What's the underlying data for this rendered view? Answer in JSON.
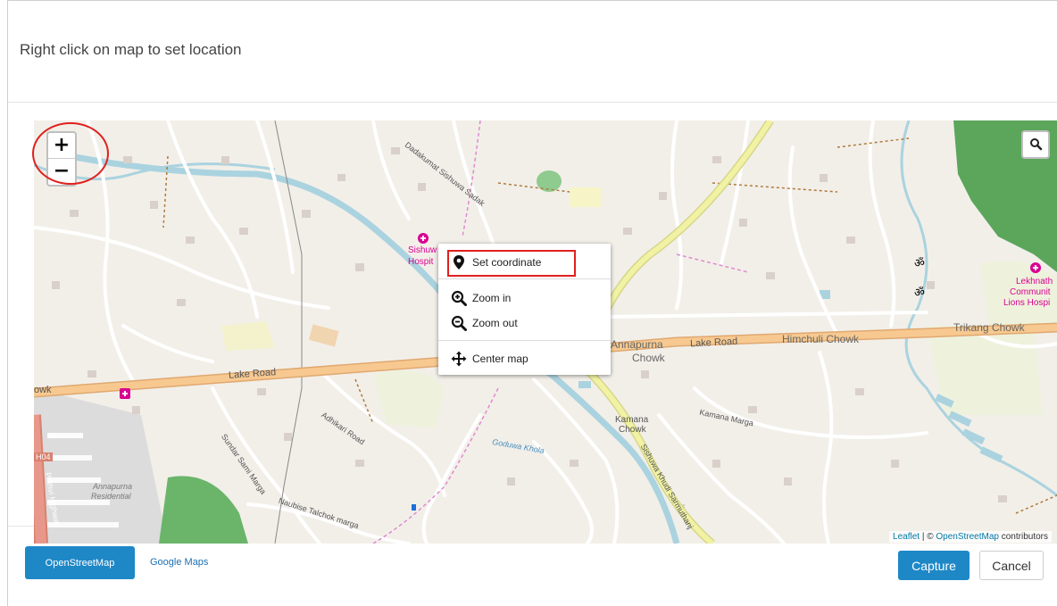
{
  "dialog": {
    "title": "Right click on map to set location"
  },
  "map": {
    "zoom_in_label": "+",
    "zoom_out_label": "−",
    "labels": {
      "lake_road_left": "Lake Road",
      "lake_road_mid": "Lake Road",
      "owk": "owk",
      "sishuwa": "Sishuw",
      "hospit": "Hospit",
      "annapurna": "Annapurna",
      "chowk": "Chowk",
      "himchuli": "Himchuli Chowk",
      "trikang": "Trikang Chowk",
      "lekhnath1": "Lekhnath",
      "lekhnath2": "Communit",
      "lekhnath3": "Lions Hospi",
      "kamana1": "Kamana",
      "kamana2": "Chowk",
      "kamana_marga": "Kamana Marga",
      "goduwa": "Goduwa Khola",
      "adhikari": "Adhikari Road",
      "sundar": "Sundar Sami Marga",
      "naubise": "Naubise Talchok marga",
      "annapurna_res1": "Annapurna",
      "annapurna_res2": "Residential",
      "prithvi": "Prithvi Highway",
      "h04": "H04",
      "sishuwa_sadak": "Dadakumat Sishuwa Sadak",
      "sishuwa_khudi": "Sishuwa Khudi Sarmuthanj",
      "om1": "ॐ",
      "om2": "ॐ"
    },
    "context_menu": {
      "set_coordinate": "Set coordinate",
      "zoom_in": "Zoom in",
      "zoom_out": "Zoom out",
      "center_map": "Center map"
    },
    "attribution": {
      "leaflet": "Leaflet",
      "sep": " | © ",
      "osm": "OpenStreetMap",
      "contributors": " contributors"
    }
  },
  "footer": {
    "osm_tab": "OpenStreetMap",
    "google_tab": "Google Maps",
    "capture": "Capture",
    "cancel": "Cancel"
  },
  "colors": {
    "primary": "#1e88c7",
    "highlight": "#e0201e",
    "trunk_road": "#f7c990",
    "primary_road": "#f1f2a4",
    "water": "#aad3df",
    "forest": "#5ca65c"
  }
}
